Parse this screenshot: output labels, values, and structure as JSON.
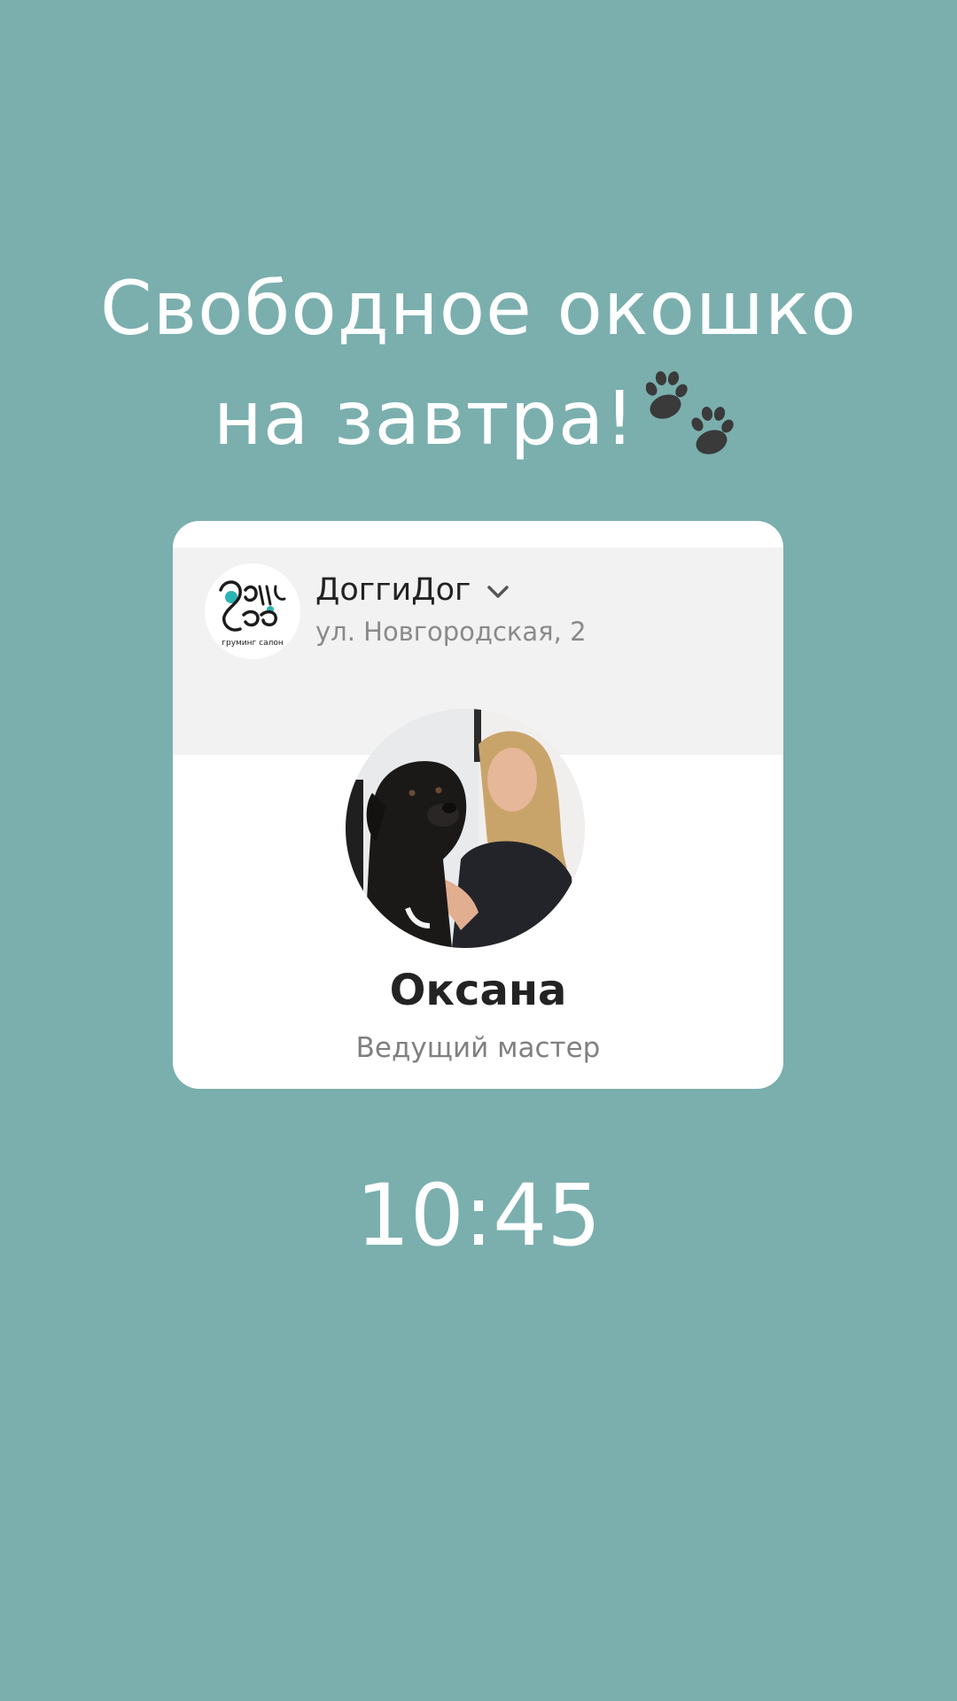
{
  "headline": {
    "line1": "Свободное окошко",
    "line2": "на завтра!",
    "emoji": "paw-prints-icon"
  },
  "card": {
    "salon": {
      "logo_icon": "doggidog-logo",
      "logo_text": "ДоггиДог",
      "logo_caption": "груминг салон",
      "name": "ДоггиДог",
      "address": "ул. Новгородская, 2",
      "dropdown_icon": "chevron-down-icon"
    },
    "master": {
      "photo": "master-photo-with-dog",
      "name": "Оксана",
      "role": "Ведущий мастер"
    }
  },
  "time": "10:45",
  "colors": {
    "background": "#7aafae",
    "card": "#ffffff",
    "card_header": "#f2f2f2",
    "headline_text": "#ffffff",
    "name_text": "#232323",
    "secondary_text": "#808080",
    "accent_teal": "#2cb3b4"
  }
}
